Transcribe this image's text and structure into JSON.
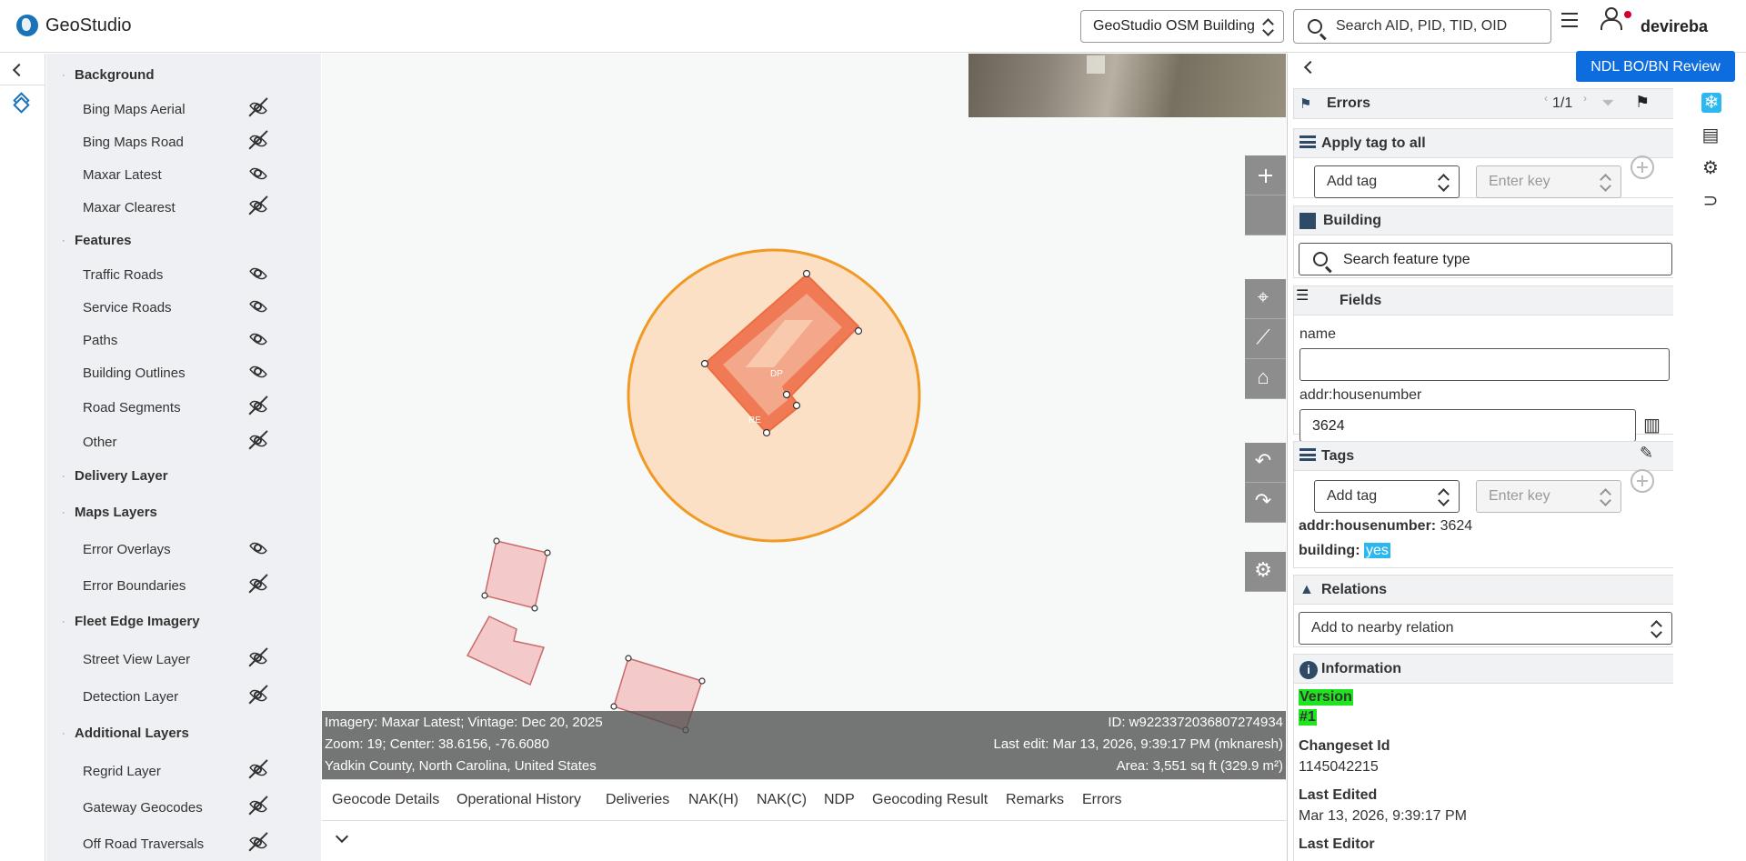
{
  "app": {
    "title": "GeoStudio",
    "username": "devireba"
  },
  "header": {
    "dataset_select": "GeoStudio OSM Building",
    "search_placeholder": "Search AID, PID, TID, OID"
  },
  "layers": [
    {
      "label": "Background",
      "kind": "group",
      "top": 0
    },
    {
      "label": "Bing Maps Aerial",
      "kind": "item",
      "visible": false
    },
    {
      "label": "Bing Maps Road",
      "kind": "item",
      "visible": false
    },
    {
      "label": "Maxar Latest",
      "kind": "item",
      "visible": true
    },
    {
      "label": "Maxar Clearest",
      "kind": "item",
      "visible": false
    },
    {
      "label": "Features",
      "kind": "group"
    },
    {
      "label": "Traffic Roads",
      "kind": "item",
      "visible": true
    },
    {
      "label": "Service Roads",
      "kind": "item",
      "visible": true
    },
    {
      "label": "Paths",
      "kind": "item",
      "visible": true
    },
    {
      "label": "Building Outlines",
      "kind": "item",
      "visible": true
    },
    {
      "label": "Road Segments",
      "kind": "item",
      "visible": false
    },
    {
      "label": "Other",
      "kind": "item",
      "visible": false
    },
    {
      "label": "Delivery Layer",
      "kind": "group"
    },
    {
      "label": "Maps Layers",
      "kind": "group"
    },
    {
      "label": "Error Overlays",
      "kind": "item",
      "visible": true
    },
    {
      "label": "Error Boundaries",
      "kind": "item",
      "visible": false
    },
    {
      "label": "Fleet Edge Imagery",
      "kind": "group"
    },
    {
      "label": "Street View Layer",
      "kind": "item",
      "visible": false
    },
    {
      "label": "Detection Layer",
      "kind": "item",
      "visible": false
    },
    {
      "label": "Additional Layers",
      "kind": "group"
    },
    {
      "label": "Regrid Layer",
      "kind": "item",
      "visible": false
    },
    {
      "label": "Gateway Geocodes",
      "kind": "item",
      "visible": false
    },
    {
      "label": "Off Road Traversals",
      "kind": "item",
      "visible": false
    }
  ],
  "map": {
    "labels": {
      "dp": "DP",
      "re": "RE"
    },
    "info": {
      "imagery": "Imagery: Maxar Latest; Vintage: Dec 20, 2025",
      "id": "ID: w9223372036807274934",
      "zoom": "Zoom: 19; Center: 38.6156, -76.6080",
      "last_edit": "Last edit: Mar 13, 2026, 9:39:17 PM (mknaresh)",
      "location": "Yadkin County, North Carolina, United States",
      "area": "Area: 3,551 sq ft (329.9 m²)"
    }
  },
  "bottom_tabs": [
    "Geocode Details",
    "Operational History",
    "Deliveries",
    "NAK(H)",
    "NAK(C)",
    "NDP",
    "Geocoding Result",
    "Remarks",
    "Errors"
  ],
  "right_panel": {
    "review_button": "NDL BO/BN Review",
    "errors": {
      "title": "Errors",
      "pager": "1/1"
    },
    "apply_tag": {
      "title": "Apply tag to all",
      "add_tag": "Add tag",
      "enter_key": "Enter key"
    },
    "building": {
      "title": "Building",
      "search_placeholder": "Search feature type"
    },
    "fields": {
      "title": "Fields",
      "name_label": "name",
      "name_value": "",
      "housenumber_label": "addr:housenumber",
      "housenumber_value": "3624"
    },
    "tags": {
      "title": "Tags",
      "add_tag": "Add tag",
      "enter_key": "Enter key",
      "k1": "addr:housenumber:",
      "v1": "3624",
      "k2": "building:",
      "v2": "yes"
    },
    "relations": {
      "title": "Relations",
      "select": "Add to nearby relation"
    },
    "information": {
      "title": "Information",
      "version_label": "Version",
      "version_value": "#1",
      "changeset_label": "Changeset Id",
      "changeset_value": "1145042215",
      "edited_label": "Last Edited",
      "edited_value": "Mar 13, 2026, 9:39:17 PM",
      "editor_label": "Last Editor"
    }
  }
}
